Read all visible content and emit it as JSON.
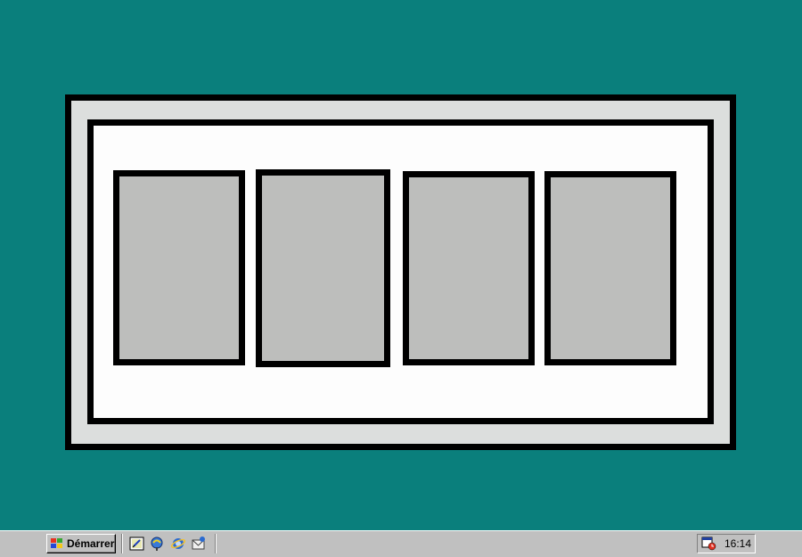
{
  "taskbar": {
    "start_label": "Démarrer",
    "clock": "16:14",
    "quick_launch": [
      {
        "name": "show-desktop",
        "icon": "show-desktop-icon"
      },
      {
        "name": "channels",
        "icon": "channels-icon"
      },
      {
        "name": "internet-explorer",
        "icon": "internet-explorer-icon"
      },
      {
        "name": "outlook-express",
        "icon": "outlook-express-icon"
      }
    ],
    "tray_icons": [
      "scheduler-icon"
    ]
  },
  "desktop": {
    "window": {
      "card_count": 4
    }
  },
  "colors": {
    "desktop": "#0a7f7c",
    "taskbar": "#c0c0c0",
    "frame_gray": "#dcdedd",
    "card": "#bdbebc"
  }
}
